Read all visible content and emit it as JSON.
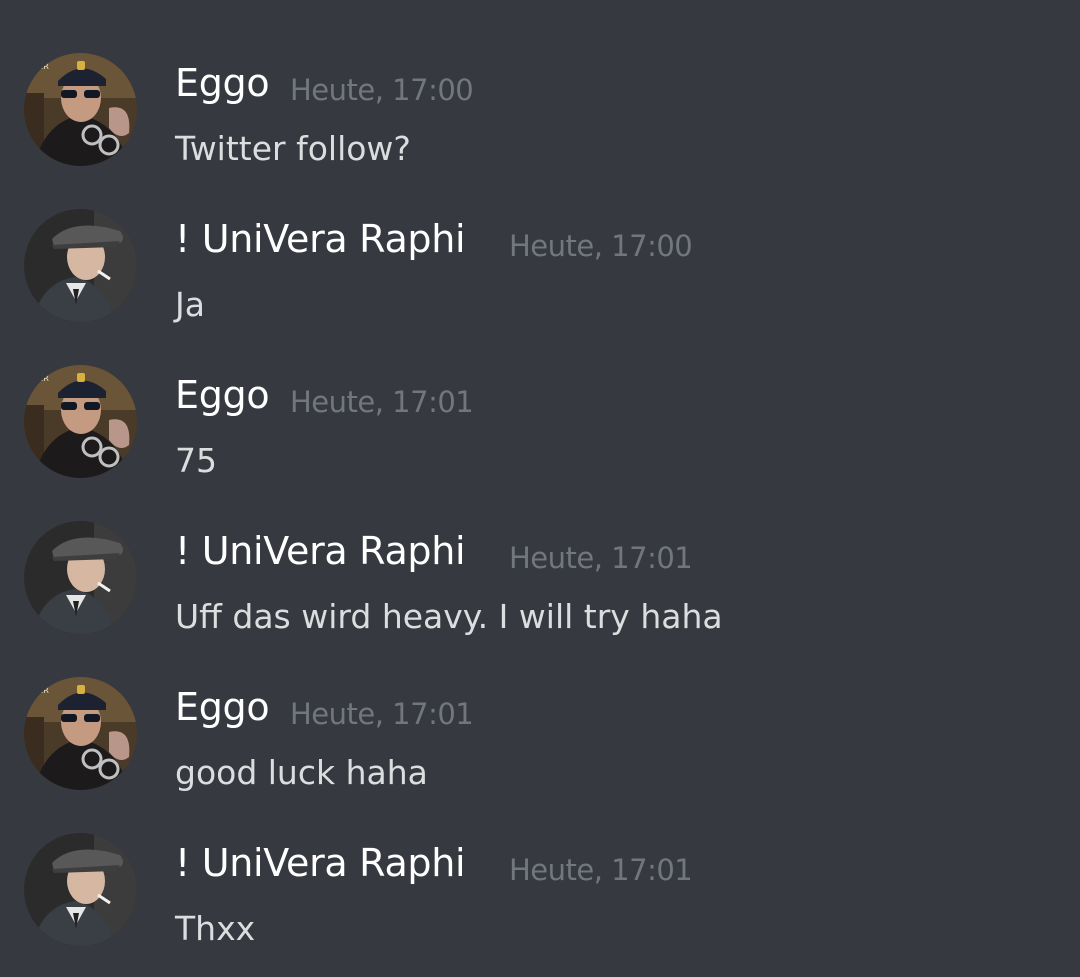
{
  "messages": [
    {
      "author": "Eggo",
      "timestamp": "Heute, 17:00",
      "text": "Twitter follow?",
      "avatar": "police-cap-avatar"
    },
    {
      "author": "! UniVera Raphi",
      "timestamp": "Heute, 17:00",
      "text": "Ja",
      "avatar": "flat-cap-avatar"
    },
    {
      "author": "Eggo",
      "timestamp": "Heute, 17:01",
      "text": "75",
      "avatar": "police-cap-avatar"
    },
    {
      "author": "! UniVera Raphi",
      "timestamp": "Heute, 17:01",
      "text": "Uff das wird heavy. I will try haha",
      "avatar": "flat-cap-avatar"
    },
    {
      "author": "Eggo",
      "timestamp": "Heute, 17:01",
      "text": "good luck haha",
      "avatar": "police-cap-avatar"
    },
    {
      "author": "! UniVera Raphi",
      "timestamp": "Heute, 17:01",
      "text": "Thxx",
      "avatar": "flat-cap-avatar"
    }
  ],
  "colors": {
    "background": "#36393f",
    "author": "#ffffff",
    "timestamp": "#72767d",
    "message_text": "#dcddde"
  }
}
